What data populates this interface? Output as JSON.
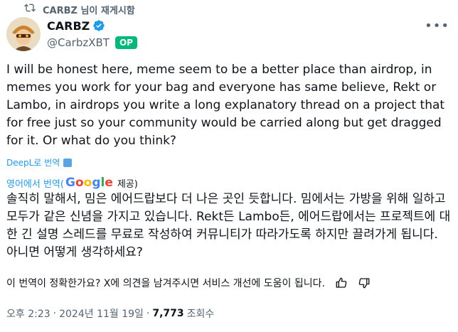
{
  "repost": {
    "text": "CARBZ 님이 재게시함",
    "icon": "repost-icon"
  },
  "author": {
    "display_name": "CARBZ",
    "handle": "@CarbzXBT",
    "badge": "OP",
    "verified_icon": "verified-badge-icon",
    "avatar_icon": "avatar-cartoon"
  },
  "more_icon": "more-options-icon",
  "tweet": {
    "text": "I will be honest here, meme seem to be a better place than airdrop, in memes you work for your bag and everyone has same believe, Rekt or Lambo, in airdrops you write a long explanatory thread on a project that for free just so your community would be carried along but get dragged for it. Or what do you think?"
  },
  "deepl": {
    "label": "DeepL로 번역",
    "icon": "deepl-icon"
  },
  "google": {
    "prefix": "영어에서 번역(",
    "logo": "Google",
    "suffix": "제공)"
  },
  "translation": {
    "text": "솔직히 말해서, 밈은 에어드랍보다 더 나은 곳인 듯합니다. 밈에서는 가방을 위해 일하고 모두가 같은 신념을 가지고 있습니다. Rekt든 Lambo든, 에어드랍에서는 프로젝트에 대한 긴 설명 스레드를 무료로 작성하여 커뮤니티가 따라가도록 하지만 끌려가게 됩니다. 아니면 어떻게 생각하세요?"
  },
  "feedback": {
    "text": "이 번역이 정확한가요? X에 의견을 남겨주시면 서비스 개선에 도움이 됩니다.",
    "up_icon": "thumbs-up-icon",
    "down_icon": "thumbs-down-icon"
  },
  "meta": {
    "time": "오후 2:23",
    "date": "2024년 11월 19일",
    "sep": "·",
    "views": "7,773",
    "views_label": "조회수"
  },
  "colors": {
    "accent": "#1d9bf0",
    "badge": "#00ba7c",
    "muted": "#536471"
  }
}
